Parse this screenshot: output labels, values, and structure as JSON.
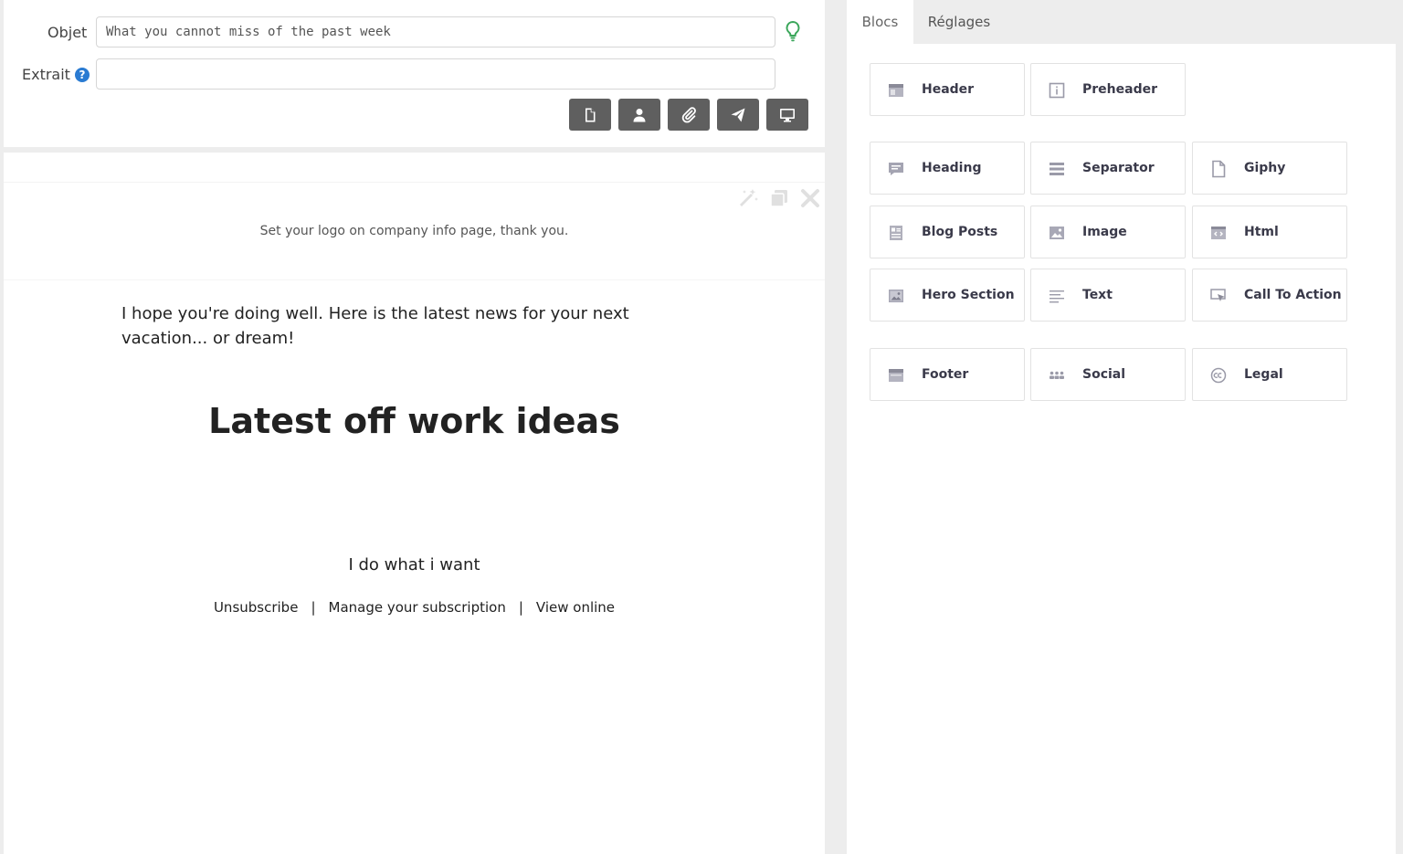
{
  "meta": {
    "subject_label": "Objet",
    "subject_value": "What you cannot miss of the past week",
    "excerpt_label": "Extrait",
    "excerpt_value": "",
    "help_glyph": "?"
  },
  "toolbar": {
    "icons": [
      "file-icon",
      "user-icon",
      "paperclip-icon",
      "send-icon",
      "desktop-icon"
    ],
    "button_color": "#5f5f5f"
  },
  "preview": {
    "logo_note": "Set your logo on company info page, thank you.",
    "intro": "I hope you're doing well. Here is the latest news for your next vacation... or dream!",
    "headline": "Latest off work ideas",
    "tagline": "I do what i want",
    "links": {
      "unsubscribe": "Unsubscribe",
      "sep1": "|",
      "manage": "Manage your subscription",
      "sep2": "|",
      "view": "View online"
    }
  },
  "tabs": {
    "blocs": "Blocs",
    "reglages": "Réglages"
  },
  "blocs": {
    "header": "Header",
    "preheader": "Preheader",
    "heading": "Heading",
    "separator": "Separator",
    "giphy": "Giphy",
    "blog_posts": "Blog Posts",
    "image": "Image",
    "html": "Html",
    "hero_section": "Hero Section",
    "text": "Text",
    "call_to_action": "Call To Action",
    "footer": "Footer",
    "social": "Social",
    "legal": "Legal"
  },
  "colors": {
    "accent_green": "#3aa65a",
    "help_blue": "#2a7bd2",
    "bloc_icon": "#9a9aa8"
  }
}
